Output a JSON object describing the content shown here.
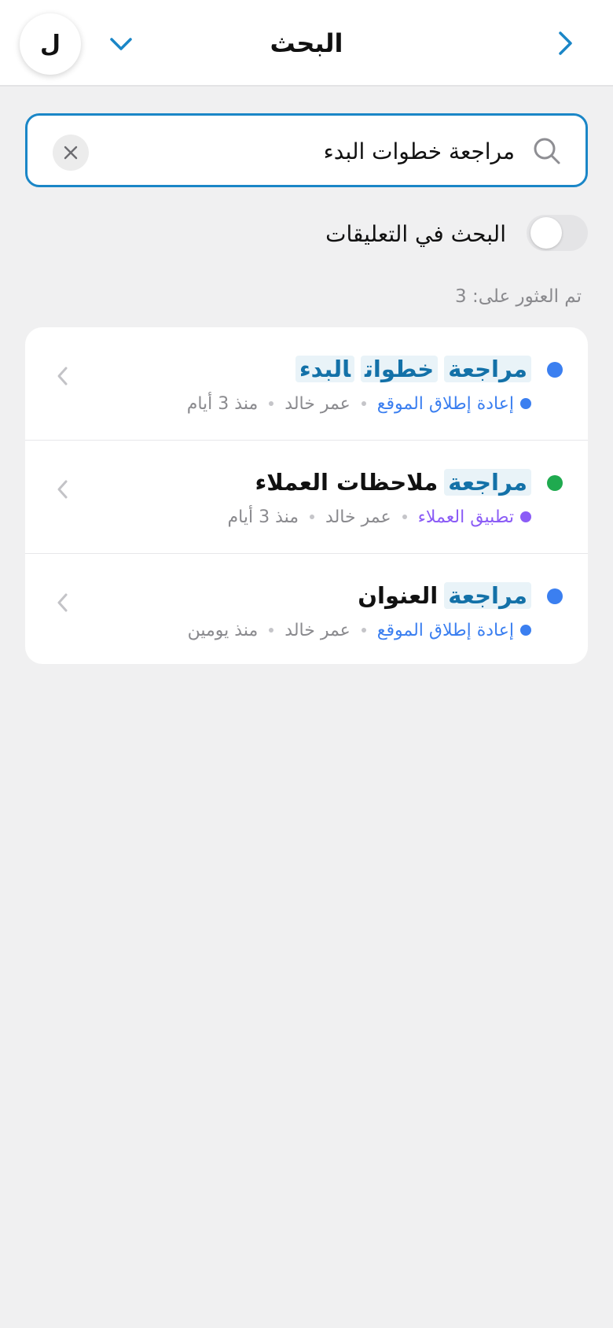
{
  "header": {
    "title": "البحث",
    "avatar_letter": "ل"
  },
  "search": {
    "value": "مراجعة خطوات البدء",
    "placeholder": ""
  },
  "toggle": {
    "label": "البحث في التعليقات",
    "on": false
  },
  "results_count": "تم العثور على: 3",
  "results": [
    {
      "title_highlights": [
        "مراجعة",
        "خطوات",
        "البدء"
      ],
      "title_rest": "",
      "status_color": "#3b7ff0",
      "project": "إعادة إطلاق الموقع",
      "project_color": "#3b7ff0",
      "author": "عمر خالد",
      "time": "منذ 3 أيام"
    },
    {
      "title_highlights": [
        "مراجعة"
      ],
      "title_rest": "ملاحظات العملاء",
      "status_color": "#1faa4f",
      "project": "تطبيق العملاء",
      "project_color": "#8b5cf6",
      "author": "عمر خالد",
      "time": "منذ 3 أيام"
    },
    {
      "title_highlights": [
        "مراجعة"
      ],
      "title_rest": "العنوان",
      "status_color": "#3b7ff0",
      "project": "إعادة إطلاق الموقع",
      "project_color": "#3b7ff0",
      "author": "عمر خالد",
      "time": "منذ يومين"
    }
  ],
  "colors": {
    "accent": "#1a86c7",
    "highlight_text": "#1371a8",
    "highlight_bg": "#e9f3f8",
    "muted": "#8a8a8e"
  },
  "icons": {
    "back": "chevron-right-icon",
    "menu": "chevron-down-icon",
    "search": "search-icon",
    "clear": "close-icon",
    "row": "chevron-left-icon"
  }
}
